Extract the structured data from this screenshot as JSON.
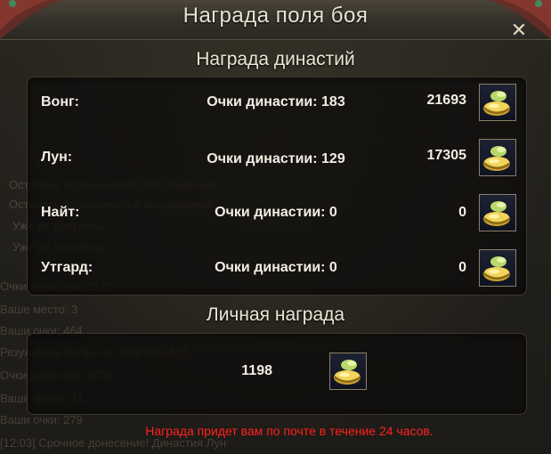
{
  "window": {
    "title": "Награда поля боя",
    "close_icon": "close-icon"
  },
  "dynasty_section": {
    "title": "Награда династий",
    "rows": [
      {
        "name": "Вонг:",
        "points": "Очки династии: 183",
        "reward": "21693",
        "icon": "treasure-chest-icon"
      },
      {
        "name": "Лун:",
        "points": "Очки династии: 129",
        "reward": "17305",
        "icon": "treasure-chest-icon"
      },
      {
        "name": "Найт:",
        "points": "Очки династии: 0",
        "reward": "0",
        "icon": "treasure-chest-icon"
      },
      {
        "name": "Утгард:",
        "points": "Очки династии: 0",
        "reward": "0",
        "icon": "treasure-chest-icon"
      }
    ]
  },
  "personal_section": {
    "title": "Личная награда",
    "reward": "1198",
    "icon": "treasure-chest-icon"
  },
  "notice": "Награда придет вам по почте в течение 24 часов.",
  "background_chat": [
    "Осталось возможностей возрождения: 3",
    "Осталось возможностей возрождения",
    "Уже не доступны",
    "Уже не доступны",
    "Очки династии: 3370",
    "Ваше место: 3",
    "Ваши очки: 464",
    "Результаты битвы на поле боя А15",
    "Очки династии: 4705",
    "Ваше место: 11",
    "Ваши очки: 279",
    "[12:03] Срочное донесение! Династия Лун"
  ],
  "colors": {
    "notice": "#ff2020",
    "text": "#f2eee4",
    "panel": "#0e0d0b"
  }
}
